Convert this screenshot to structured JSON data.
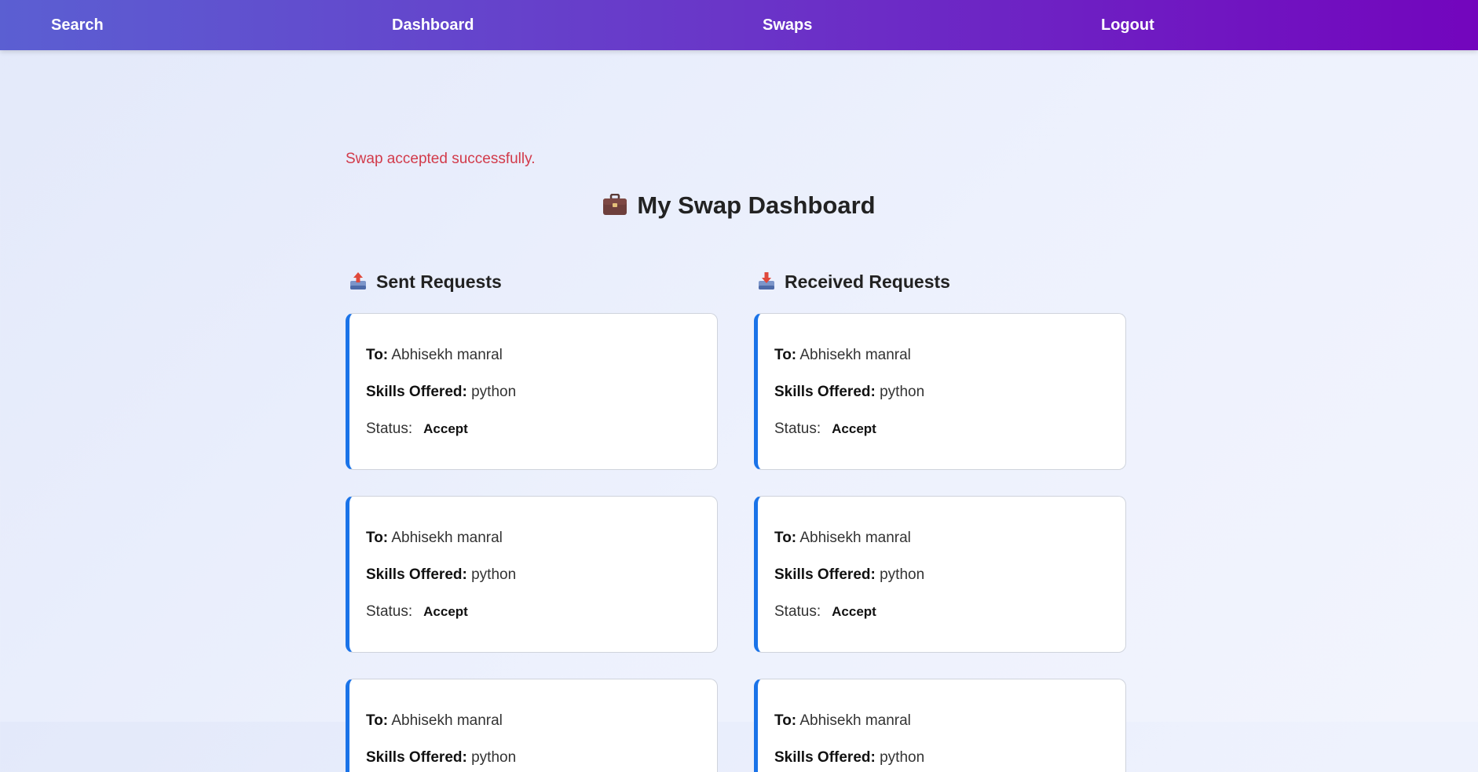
{
  "nav": {
    "items": [
      {
        "label": "Search"
      },
      {
        "label": "Dashboard"
      },
      {
        "label": "Swaps"
      },
      {
        "label": "Logout"
      }
    ]
  },
  "flash_message": "Swap accepted successfully.",
  "page_title": "My Swap Dashboard",
  "page_title_icon": "briefcase-icon",
  "sent": {
    "heading": "Sent Requests",
    "icon": "outbox-tray-icon",
    "cards": [
      {
        "to_label": "To:",
        "to_value": "Abhisekh manral",
        "skills_label": "Skills Offered:",
        "skills_value": "python",
        "status_label": "Status:",
        "status_value": "Accept"
      },
      {
        "to_label": "To:",
        "to_value": "Abhisekh manral",
        "skills_label": "Skills Offered:",
        "skills_value": "python",
        "status_label": "Status:",
        "status_value": "Accept"
      },
      {
        "to_label": "To:",
        "to_value": "Abhisekh manral",
        "skills_label": "Skills Offered:",
        "skills_value": "python"
      }
    ]
  },
  "received": {
    "heading": "Received Requests",
    "icon": "inbox-tray-icon",
    "cards": [
      {
        "to_label": "To:",
        "to_value": "Abhisekh manral",
        "skills_label": "Skills Offered:",
        "skills_value": "python",
        "status_label": "Status:",
        "status_value": "Accept"
      },
      {
        "to_label": "To:",
        "to_value": "Abhisekh manral",
        "skills_label": "Skills Offered:",
        "skills_value": "python",
        "status_label": "Status:",
        "status_value": "Accept"
      },
      {
        "to_label": "To:",
        "to_value": "Abhisekh manral",
        "skills_label": "Skills Offered:",
        "skills_value": "python"
      }
    ]
  },
  "colors": {
    "nav_start": "#5b5fd2",
    "nav_end": "#7305bd",
    "card_accent": "#1a73e8",
    "flash_text": "#d23a4a"
  }
}
